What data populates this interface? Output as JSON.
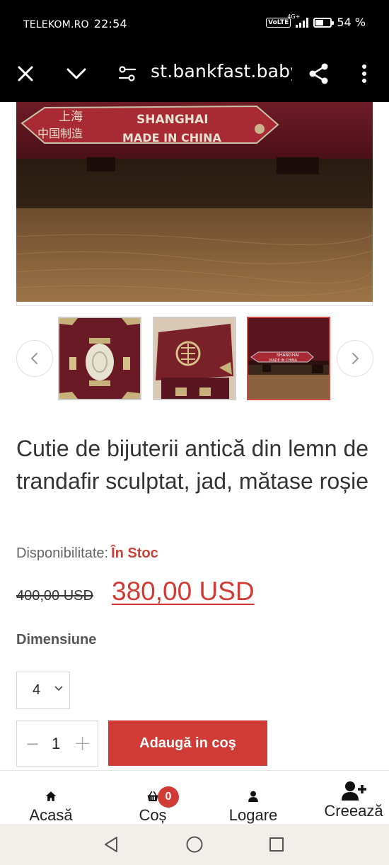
{
  "status_bar": {
    "carrier": "TELEKOM.RO",
    "time": "22:54",
    "volte": "VoLTE",
    "network": "4G+",
    "battery": "54 %"
  },
  "browser": {
    "url": "st.bankfast.baby",
    "icons": [
      "close-icon",
      "chevron-down-icon",
      "site-settings-icon",
      "share-icon",
      "more-vert-icon"
    ]
  },
  "gallery": {
    "hero_label_1": "SHANGHAI",
    "hero_label_2": "MADE IN CHINA",
    "thumbs": [
      "thumb-front",
      "thumb-top",
      "thumb-label"
    ],
    "selected_thumb": 2
  },
  "product": {
    "title": "Cutie de bijuterii antică din lemn de trandafir sculptat, jad, mătase roșie",
    "availability_label": "Disponibilitate:",
    "availability_value": "În Stoc",
    "old_price": "400,00 USD",
    "new_price": "380,00 USD",
    "dimension_label": "Dimensiune",
    "dimension_value": "4",
    "quantity": "1",
    "add_to_cart": "Adaugă in coş"
  },
  "app_nav": {
    "home": "Acasă",
    "cart": "Coș",
    "cart_count": "0",
    "login": "Logare",
    "create": "Creează"
  },
  "colors": {
    "accent": "#d03b35",
    "wood_red": "#7a1e28"
  }
}
